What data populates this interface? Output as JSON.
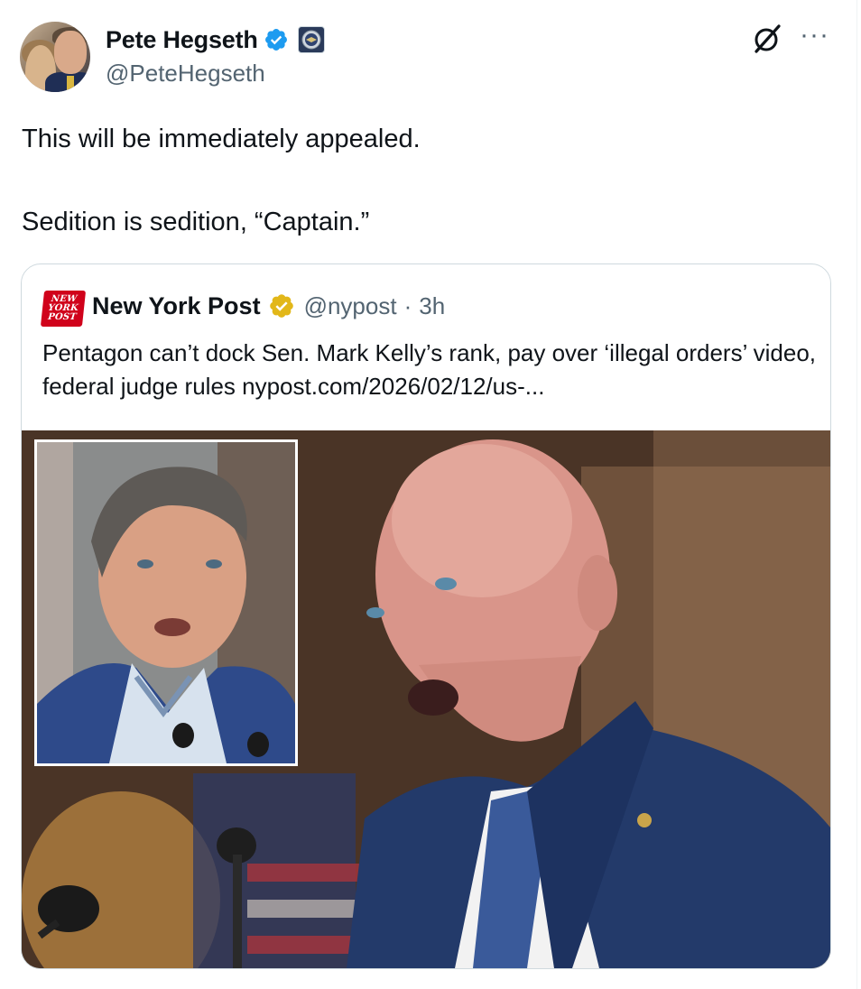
{
  "author": {
    "display_name": "Pete Hegseth",
    "handle": "@PeteHegseth",
    "verified": true,
    "affiliate_badge": "department-seal-icon"
  },
  "header_actions": {
    "grok_icon": "grok-icon",
    "more_label": "···"
  },
  "tweet": {
    "line1": "This will be immediately appealed.",
    "line2": "Sedition is sedition, “Captain.”"
  },
  "quoted": {
    "logo_lines": [
      "NEW",
      "YORK",
      "POST"
    ],
    "name": "New York Post",
    "handle": "@nypost",
    "separator": "·",
    "time": "3h",
    "text": "Pentagon can’t dock Sen. Mark Kelly’s rank, pay over ‘illegal orders’ video, federal judge rules nypost.com/2026/02/12/us-...",
    "verified_color": "#e2b719"
  },
  "colors": {
    "text": "#0f1419",
    "secondary": "#536471",
    "verified_blue": "#1d9bf0",
    "nyp_red": "#d0021b"
  }
}
